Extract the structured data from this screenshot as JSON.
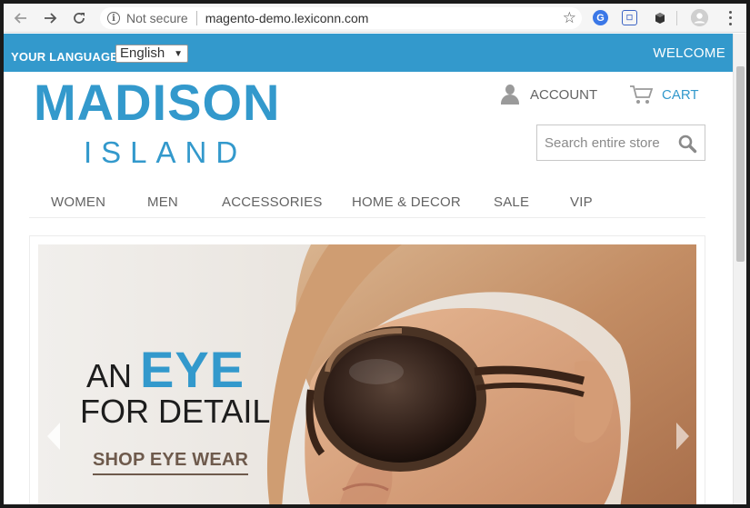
{
  "browser": {
    "security_label": "Not secure",
    "url": "magento-demo.lexiconn.com",
    "extension_g_label": "G"
  },
  "header": {
    "language_label": "YOUR LANGUAGE:",
    "language_selected": "English",
    "welcome": "WELCOME"
  },
  "logo": {
    "line1": "MADISON",
    "line2": "ISLAND"
  },
  "account_label": "ACCOUNT",
  "cart_label": "CART",
  "search": {
    "placeholder": "Search entire store"
  },
  "nav": [
    {
      "label": "WOMEN"
    },
    {
      "label": "MEN"
    },
    {
      "label": "ACCESSORIES"
    },
    {
      "label": "HOME & DECOR"
    },
    {
      "label": "SALE"
    },
    {
      "label": "VIP"
    }
  ],
  "hero": {
    "line1_prefix": "AN",
    "line1_highlight": "EYE",
    "line2": "FOR DETAIL",
    "cta": "SHOP EYE WEAR"
  },
  "colors": {
    "brand_blue": "#3399cc",
    "cta_brown": "#6e5a4c",
    "nav_text": "#636363"
  },
  "icons": [
    "back-arrow-icon",
    "forward-arrow-icon",
    "reload-icon",
    "info-icon",
    "star-icon",
    "grammarly-icon",
    "badge-icon",
    "cube-icon",
    "profile-icon",
    "kebab-menu-icon",
    "account-icon",
    "cart-icon",
    "search-icon"
  ]
}
